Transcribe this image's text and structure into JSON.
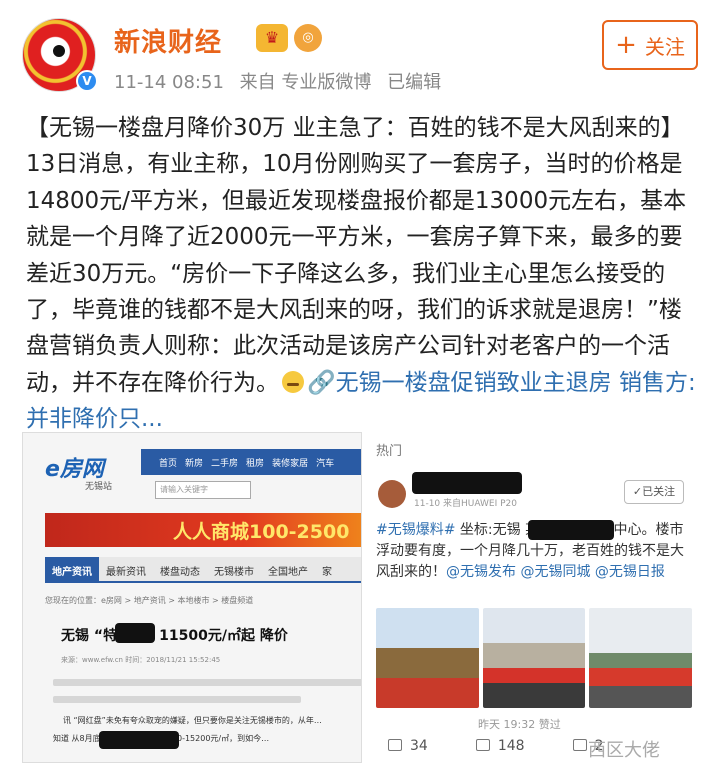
{
  "post": {
    "user_name": "新浪财经",
    "crown_badge": "crown-icon",
    "medal_badge": "medal-icon",
    "time": "11-14 08:51",
    "source": "来自 专业版微博",
    "edited": "已编辑",
    "follow_label": "关注",
    "text_before_emoji": "【无锡一楼盘月降价30万 业主急了：百姓的钱不是大风刮来的】13日消息，有业主称，10月份刚购买了一套房子，当时的价格是14800元/平方米，但最近发现楼盘报价都是13000元左右，基本就是一个月降了近2000元一平方米，一套房子算下来，最多的要差近30万元。“房价一下子降这么多，我们业主心里怎么接受的了，毕竟谁的钱都不是大风刮来的呀，我们的诉求就是退房！”楼盘营销负责人则称：此次活动是该房产公司针对老客户的一个活动，并不存在降价行为。",
    "link_text": "🔗无锡一楼盘促销致业主退房 销售方:并非降价只..."
  },
  "news_image": {
    "logo": "e房网",
    "logo_sub": "无锡站",
    "nav": [
      "首页",
      "新房",
      "二手房",
      "租房",
      "装修家居",
      "汽车"
    ],
    "search_placeholder": "请输入关键字",
    "banner": "人人商城100-2500",
    "tabs": [
      "地产资讯",
      "最新资讯",
      "楼盘动态",
      "无锡楼市",
      "全国地产",
      "家"
    ],
    "crumb": "您现在的位置：e房网 > 地产资讯 > 本地楼市 > 楼盘频道",
    "headline": "无锡    “特价房” 11500元/㎡起 降价",
    "info": "来源：www.efw.cn   时间：2018/11/21 15:52:45",
    "para1": "讯 “网红盘”未免有夸众取宠的嫌疑，但只要你是关注无锡楼市的，从年…",
    "para2": "知道         从8月底加推的高层均价14800-15200元/㎡，到如今…"
  },
  "weibo_image": {
    "hot_label": "热门",
    "time": "11-10 来自HUAWEI P20",
    "follow": "✓已关注",
    "text_prefix": "#无锡爆料#",
    "text_main": " 坐标:无锡      某楼盘   下售楼中心。楼市浮动要有度，一个月降几十万，老百姓的钱不是大风刮来的！",
    "mentions": "@无锡发布 @无锡同城 @无锡日报",
    "meta_line": "昨天 19:32 赞过",
    "repost_count": "34",
    "comment_count": "148",
    "like_count": "2"
  },
  "watermark": "西区大佬"
}
